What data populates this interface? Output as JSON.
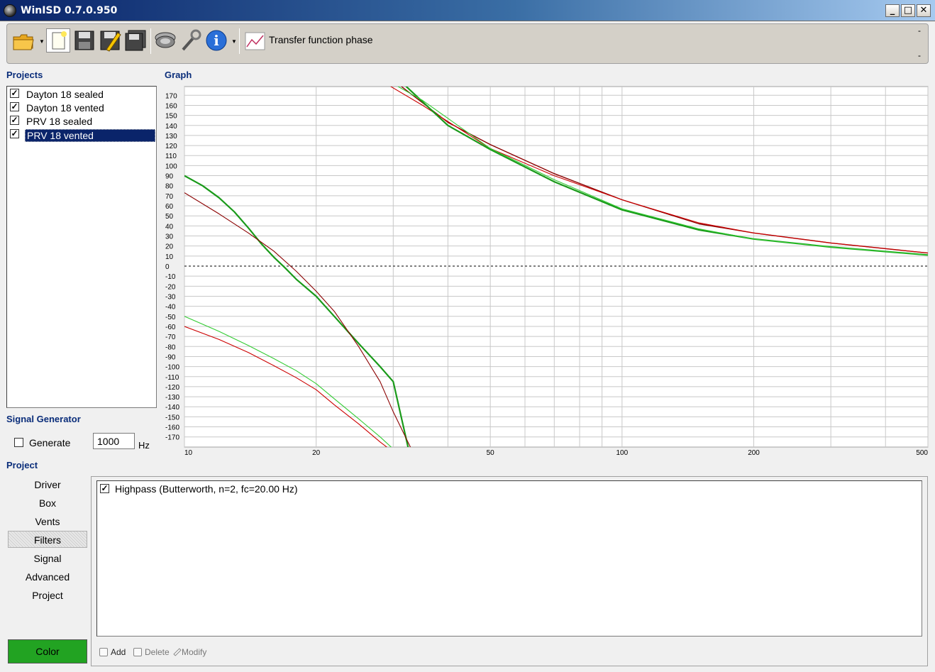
{
  "window": {
    "title": "WinISD 0.7.0.950",
    "min_glyph": "_",
    "max_glyph": "□",
    "close_glyph": "✕"
  },
  "toolbar": {
    "graph_type_label": "Transfer function phase",
    "dash_top": "-",
    "dash_bottom": "-"
  },
  "projects": {
    "label": "Projects",
    "items": [
      {
        "label": "Dayton 18 sealed",
        "checked": true
      },
      {
        "label": "Dayton 18 vented",
        "checked": true
      },
      {
        "label": "PRV 18 sealed",
        "checked": true
      },
      {
        "label": "PRV 18 vented",
        "checked": true,
        "selected": true
      }
    ]
  },
  "graph": {
    "label": "Graph"
  },
  "signal_generator": {
    "label": "Signal Generator",
    "generate_label": "Generate",
    "frequency_value": "1000",
    "unit": "Hz"
  },
  "project": {
    "label": "Project",
    "menu": [
      "Driver",
      "Box",
      "Vents",
      "Filters",
      "Signal",
      "Advanced",
      "Project"
    ],
    "active_menu": "Filters",
    "color_button": "Color"
  },
  "filters": {
    "items": [
      {
        "label": "Highpass (Butterworth, n=2, fc=20.00 Hz)",
        "checked": true
      }
    ],
    "add_label": "Add",
    "delete_label": "Delete",
    "modify_label": "Modify"
  },
  "colors": {
    "dark_red": "#8b0000",
    "red": "#cc0000",
    "dark_green": "#1a9a1a",
    "light_green": "#33cc33",
    "accent": "#0a246a"
  },
  "chart_data": {
    "type": "line",
    "xscale": "log",
    "xlim": [
      10,
      500
    ],
    "ylim": [
      -180,
      180
    ],
    "x_ticks": [
      10,
      20,
      50,
      100,
      200,
      500
    ],
    "y_ticks": [
      170,
      160,
      150,
      140,
      130,
      120,
      110,
      100,
      90,
      80,
      70,
      60,
      50,
      40,
      30,
      20,
      10,
      0,
      -10,
      -20,
      -30,
      -40,
      -50,
      -60,
      -70,
      -80,
      -90,
      -100,
      -110,
      -120,
      -130,
      -140,
      -150,
      -160,
      -170
    ],
    "grid": true,
    "zero_line": "dashed",
    "series": [
      {
        "color": "#8b0000",
        "width": 1.4,
        "x": [
          30,
          40,
          50,
          70,
          100,
          150,
          200,
          300,
          500
        ],
        "values": [
          185,
          143,
          121,
          92,
          66,
          42,
          33,
          23,
          13
        ]
      },
      {
        "color": "#cc0000",
        "width": 1.1,
        "x": [
          28,
          35,
          50,
          70,
          100,
          150,
          200,
          300,
          500
        ],
        "values": [
          185,
          160,
          117,
          90,
          66,
          43,
          33,
          23,
          13
        ]
      },
      {
        "color": "#1a9a1a",
        "width": 2.2,
        "x": [
          31,
          40,
          50,
          70,
          100,
          150,
          200,
          300,
          500
        ],
        "values": [
          185,
          140,
          116,
          84,
          56,
          36,
          27,
          19,
          11
        ]
      },
      {
        "color": "#33cc33",
        "width": 1.1,
        "x": [
          29,
          35,
          50,
          70,
          100,
          150,
          200,
          300,
          500
        ],
        "values": [
          185,
          165,
          117,
          86,
          57,
          37,
          27,
          19,
          11
        ]
      },
      {
        "color": "#1a9a1a",
        "width": 2.2,
        "x": [
          10,
          11,
          12,
          13,
          14,
          15,
          16,
          17,
          18,
          20,
          22,
          25,
          28,
          30,
          32.5
        ],
        "values": [
          90,
          80,
          68,
          54,
          38,
          22,
          9,
          -2,
          -13,
          -30,
          -50,
          -77,
          -100,
          -115,
          -182
        ]
      },
      {
        "color": "#8b0000",
        "width": 1.1,
        "x": [
          10,
          12,
          14,
          16,
          18,
          20,
          22,
          25,
          28,
          30,
          33
        ],
        "values": [
          73,
          52,
          33,
          15,
          -5,
          -25,
          -45,
          -80,
          -115,
          -145,
          -182
        ]
      },
      {
        "color": "#33cc33",
        "width": 1.1,
        "x": [
          10,
          12,
          14,
          16,
          18,
          20,
          22,
          25,
          28,
          30
        ],
        "values": [
          -50,
          -65,
          -79,
          -92,
          -104,
          -117,
          -132,
          -152,
          -170,
          -182
        ]
      },
      {
        "color": "#cc0000",
        "width": 1.1,
        "x": [
          10,
          12,
          14,
          16,
          18,
          20,
          22,
          25,
          28,
          30
        ],
        "values": [
          -60,
          -73,
          -86,
          -99,
          -111,
          -123,
          -138,
          -157,
          -175,
          -185
        ]
      }
    ]
  }
}
